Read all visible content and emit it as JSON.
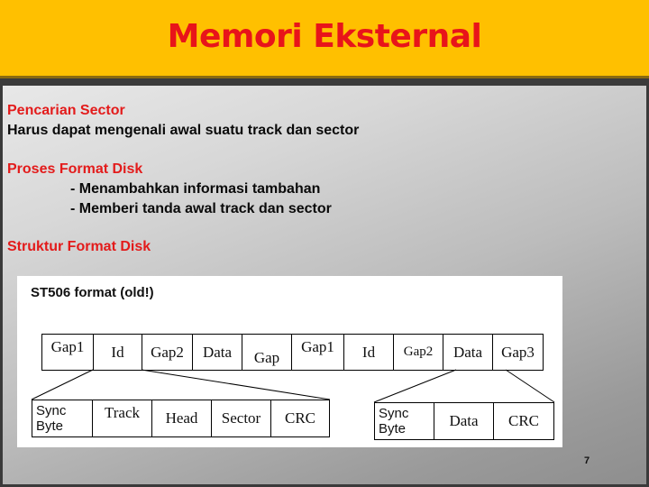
{
  "slide": {
    "title": "Memori Eksternal",
    "sections": [
      {
        "heading": "Pencarian Sector",
        "lines": [
          "Harus dapat mengenali awal suatu track dan sector"
        ]
      },
      {
        "heading": "Proses Format Disk",
        "lines": [
          "- Menambahkan informasi tambahan",
          "- Memberi tanda awal track dan sector"
        ]
      },
      {
        "heading": "Struktur Format Disk",
        "lines": []
      }
    ],
    "page_number": "7"
  },
  "diagram": {
    "title": "ST506 format (old!)",
    "main_row": [
      "Gap1",
      "Id",
      "Gap2",
      "Data",
      "Gap",
      "Gap1",
      "Id",
      "Gap2",
      "Data",
      "Gap3"
    ],
    "id_field_row": [
      "Sync\nByte",
      "Track",
      "Head",
      "Sector",
      "CRC"
    ],
    "data_field_row": [
      "Sync\nByte",
      "Data",
      "CRC"
    ]
  },
  "colors": {
    "header_bg": "#ffc000",
    "title_red": "#e8141a",
    "heading_red": "#e31b1b"
  }
}
